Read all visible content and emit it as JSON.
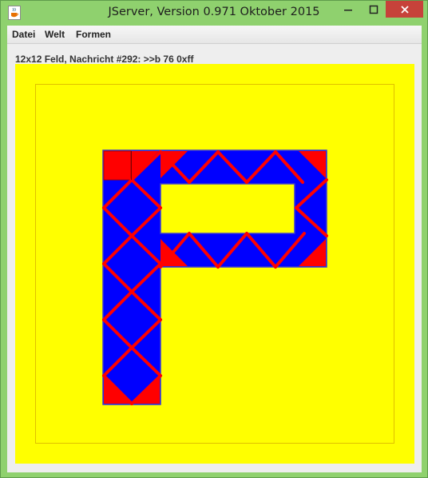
{
  "window": {
    "title": "JServer, Version 0.971 Oktober 2015",
    "app_icon": "java-cup-icon",
    "controls": [
      "minimize-icon",
      "maximize-icon",
      "close-icon"
    ]
  },
  "menu": {
    "items": [
      "Datei",
      "Welt",
      "Formen"
    ]
  },
  "status": {
    "text": "12x12 Feld, Nachricht #292: >>b 76 0xff"
  },
  "board": {
    "size": 12,
    "colors": {
      "background": "#ffff00",
      "fill": "#0000ff",
      "accent": "#ff0000",
      "frame": "#e0c000"
    }
  }
}
